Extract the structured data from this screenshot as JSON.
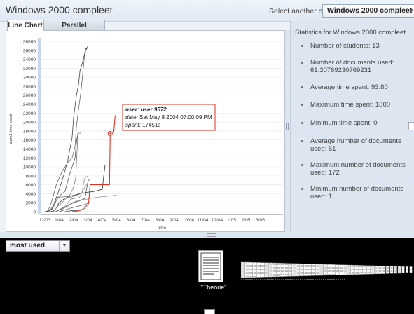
{
  "header": {
    "title": "Windows 2000 compleet",
    "select_label": "Select another course:",
    "course_value": "Windows 2000 compleet"
  },
  "tabs": [
    {
      "label": "Line Chart",
      "active": true
    },
    {
      "label": "Parallel Coordinates",
      "active": false
    }
  ],
  "chart_data": {
    "type": "line",
    "title": "",
    "xlabel": "time",
    "ylabel": "cumul. time spent",
    "ylim": [
      0,
      38000
    ],
    "yticks": [
      0,
      2000,
      4000,
      6000,
      8000,
      10000,
      12000,
      14000,
      16000,
      18000,
      20000,
      22000,
      24000,
      26000,
      28000,
      30000,
      32000,
      34000,
      36000,
      38000
    ],
    "xticks": [
      "12/03",
      "1/04",
      "2/04",
      "3/04",
      "4/04",
      "5/04",
      "6/04",
      "7/04",
      "8/04",
      "9/04",
      "10/04",
      "11/04",
      "12/04",
      "1/05",
      "2/05",
      "3/05"
    ],
    "series": [
      {
        "color": "#444444",
        "points": [
          [
            0.0,
            0
          ],
          [
            0.3,
            200
          ],
          [
            0.5,
            600
          ],
          [
            0.6,
            1500
          ],
          [
            0.9,
            4000
          ],
          [
            1.3,
            8000
          ],
          [
            1.6,
            11500
          ],
          [
            1.9,
            16500
          ],
          [
            2.0,
            21000
          ],
          [
            2.2,
            26000
          ],
          [
            2.35,
            28500
          ],
          [
            2.45,
            31500
          ],
          [
            2.6,
            33000
          ],
          [
            2.75,
            35000
          ],
          [
            2.85,
            36500
          ],
          [
            2.9,
            36200
          ],
          [
            3.0,
            37000
          ]
        ]
      },
      {
        "color": "#666666",
        "points": [
          [
            0.2,
            0
          ],
          [
            0.5,
            2500
          ],
          [
            0.8,
            6000
          ],
          [
            1.2,
            9000
          ],
          [
            1.6,
            11000
          ],
          [
            1.9,
            12000
          ],
          [
            2.1,
            14500
          ],
          [
            2.2,
            19000
          ],
          [
            2.35,
            23000
          ],
          [
            2.5,
            26500
          ],
          [
            2.6,
            29500
          ],
          [
            2.75,
            34500
          ],
          [
            2.85,
            36000
          ]
        ]
      },
      {
        "color": "#555555",
        "points": [
          [
            0.2,
            0
          ],
          [
            0.4,
            400
          ],
          [
            0.6,
            1000
          ],
          [
            0.8,
            2500
          ],
          [
            1.0,
            3500
          ],
          [
            1.4,
            4500
          ],
          [
            1.7,
            8000
          ],
          [
            1.9,
            10000
          ],
          [
            2.1,
            12000
          ],
          [
            2.2,
            15500
          ],
          [
            2.3,
            17500
          ]
        ]
      },
      {
        "color": "#777777",
        "points": [
          [
            0.3,
            0
          ],
          [
            0.6,
            1500
          ],
          [
            0.9,
            3200
          ],
          [
            1.3,
            3300
          ],
          [
            1.7,
            3400
          ],
          [
            2.0,
            5500
          ],
          [
            2.15,
            7500
          ],
          [
            2.3,
            17500
          ],
          [
            2.45,
            17500
          ],
          [
            2.5,
            17600
          ]
        ]
      },
      {
        "color": "#333333",
        "points": [
          [
            0.4,
            0
          ],
          [
            0.7,
            300
          ],
          [
            1.0,
            2000
          ],
          [
            1.4,
            3000
          ],
          [
            1.8,
            3500
          ],
          [
            2.1,
            3700
          ],
          [
            2.4,
            4000
          ],
          [
            2.9,
            4300
          ],
          [
            3.4,
            4500
          ],
          [
            4.0,
            5000
          ],
          [
            4.1,
            8000
          ],
          [
            4.2,
            10500
          ]
        ]
      },
      {
        "color": "#888888",
        "points": [
          [
            0.6,
            0
          ],
          [
            0.9,
            1200
          ],
          [
            1.2,
            2000
          ],
          [
            1.5,
            3000
          ],
          [
            1.8,
            3200
          ],
          [
            2.2,
            3600
          ],
          [
            2.6,
            4200
          ],
          [
            2.7,
            6500
          ],
          [
            2.8,
            7500
          ],
          [
            3.0,
            8000
          ]
        ]
      },
      {
        "color": "#999999",
        "points": [
          [
            0.7,
            0
          ],
          [
            1.1,
            500
          ],
          [
            1.5,
            1000
          ],
          [
            1.9,
            2000
          ],
          [
            2.3,
            2500
          ],
          [
            2.8,
            2700
          ],
          [
            3.2,
            3000
          ],
          [
            3.6,
            3200
          ],
          [
            4.2,
            3400
          ],
          [
            4.8,
            3600
          ],
          [
            5.0,
            3700
          ]
        ]
      },
      {
        "color": "#5a5a5a",
        "points": [
          [
            0.8,
            0
          ],
          [
            1.2,
            800
          ],
          [
            1.6,
            1300
          ],
          [
            2.0,
            2000
          ],
          [
            2.4,
            2400
          ],
          [
            2.8,
            3000
          ],
          [
            3.0,
            6800
          ],
          [
            3.1,
            7200
          ]
        ]
      },
      {
        "color": "#6a6a6a",
        "points": [
          [
            1.0,
            0
          ],
          [
            1.4,
            400
          ],
          [
            1.8,
            800
          ],
          [
            2.3,
            1200
          ],
          [
            2.8,
            1600
          ],
          [
            3.1,
            2000
          ]
        ]
      },
      {
        "color": "#4a4a4a",
        "points": [
          [
            1.4,
            0
          ],
          [
            1.8,
            200
          ],
          [
            2.2,
            300
          ],
          [
            2.5,
            400
          ],
          [
            2.6,
            500
          ]
        ]
      },
      {
        "color": "#7a7a7a",
        "points": [
          [
            1.1,
            0
          ],
          [
            1.5,
            1500
          ],
          [
            1.8,
            2800
          ],
          [
            2.1,
            3000
          ],
          [
            2.4,
            3100
          ],
          [
            2.7,
            5000
          ],
          [
            2.9,
            6000
          ]
        ]
      },
      {
        "color": "#3a3a3a",
        "points": [
          [
            0.1,
            0
          ],
          [
            0.2,
            200
          ],
          [
            0.25,
            400
          ],
          [
            0.3,
            300
          ]
        ]
      },
      {
        "color": "#dd3322",
        "highlight": true,
        "points": [
          [
            1.9,
            0
          ],
          [
            2.4,
            200
          ],
          [
            2.7,
            600
          ],
          [
            3.05,
            1800
          ],
          [
            3.15,
            6000
          ],
          [
            3.6,
            6000
          ],
          [
            4.0,
            6000
          ],
          [
            4.5,
            6000
          ],
          [
            4.55,
            17451
          ],
          [
            4.8,
            17800
          ],
          [
            4.9,
            21500
          ]
        ]
      }
    ],
    "tooltip": {
      "user_label": "user:",
      "user_value": "user 9572",
      "date_label": "date:",
      "date_value": "Sat May 8 2004 07:00:09 PM",
      "spent_label": "spent:",
      "spent_value": "17451s",
      "point": [
        4.55,
        17451
      ]
    }
  },
  "stats": {
    "title": "Statistics for Windows 2000 compleet",
    "items": [
      "Number of students: 13",
      "Number of documents used: 61.30769230769231",
      "Average time spent: 93.80",
      "Maximum time spent: 1800",
      "Minimum time spent: 0",
      "Average number of documents used: 61",
      "Maximum number of documents used: 172",
      "Minimum number of documents used: 1"
    ]
  },
  "bottom": {
    "filter_value": "most used",
    "document_label": "\"Theorie\""
  }
}
